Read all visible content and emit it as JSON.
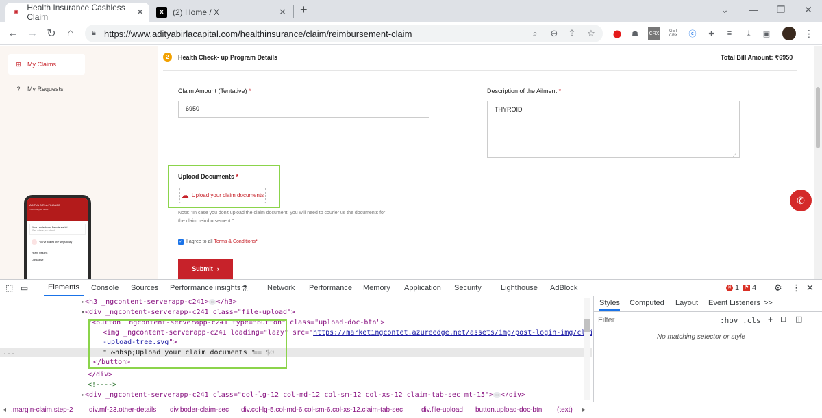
{
  "browser": {
    "tabs": [
      {
        "title": "Health Insurance Cashless Claim",
        "active": true,
        "icon": "aditya-birla-logo"
      },
      {
        "title": "(2) Home / X",
        "active": false,
        "icon": "x-logo"
      }
    ],
    "new_tab": "+",
    "url": "https://www.adityabirlacapital.com/healthinsurance/claim/reimbursement-claim",
    "extensions": [
      "opera-icon",
      "profile-icon",
      "crx-icon",
      "get-crx-icon",
      "clipboard-icon",
      "puzzle-icon",
      "media-icon",
      "download-icon",
      "sidepanel-icon",
      "avatar"
    ]
  },
  "sidebar": {
    "items": [
      {
        "label": "My Claims",
        "icon": "claims-icon",
        "active": true
      },
      {
        "label": "My Requests",
        "icon": "requests-icon",
        "active": false
      }
    ],
    "phone": {
      "brand": "ADITYA BIRLA FINANCE",
      "greeting": "Your Today for Good",
      "leader": "Your Leaderboard Results are In!",
      "leader_sub": "See where you stand",
      "steps": "You've walked 5K+ steps today",
      "returns": "Health Returns",
      "cumulative": "Cumulative"
    }
  },
  "form": {
    "step_number": "2",
    "section_title": "Health Check- up Program Details",
    "total_bill": "Total Bill Amount: ₹6950",
    "claim_amount_label": "Claim Amount (Tentative)",
    "claim_amount_value": "6950",
    "ailment_label": "Description of the Ailment",
    "ailment_value": "THYROID",
    "upload_label": "Upload Documents",
    "upload_button": "Upload your claim documents",
    "note_line1": "Note: \"In case you don't upload the claim document, you will need to courier us the documents for",
    "note_line2": "the claim reimbursement.\"",
    "agree_prefix": "I agree to all",
    "agree_link": "Terms & Conditions",
    "submit": "Submit",
    "required_mark": "*"
  },
  "devtools": {
    "tabs": [
      "Elements",
      "Console",
      "Sources",
      "Performance insights",
      "Network",
      "Performance",
      "Memory",
      "Application",
      "Security",
      "Lighthouse",
      "AdBlock"
    ],
    "active_tab": "Elements",
    "error_count": "1",
    "issue_count": "4",
    "code": {
      "l1_tag": "<h3 _ngcontent-serverapp-c241>",
      "l1_close": "</h3>",
      "l2_open": "<div _ngcontent-serverapp-c241 class=\"file-upload\">",
      "l3_button": "<button _ngcontent-serverapp-c241 type=\"button\" class=\"upload-doc-btn\">",
      "l4_img": "<img _ngcontent-serverapp-c241 loading=\"lazy\" src=\"",
      "l4_src": "https://marketingcontet.azureedge.net/assets/img/post-login-img/claim",
      "l5_src": "-upload-tree.svg",
      "l5_close": "\">",
      "l6_text": "\" &nbsp;Upload your claim documents \"",
      "l6_eq": "== $0",
      "l7": "</button>",
      "l8": "</div>",
      "l9": "<!---->",
      "l10": "<div _ngcontent-serverapp-c241 class=\"col-lg-12 col-md-12 col-sm-12 col-xs-12 claim-tab-sec mt-15\">",
      "l10_close": "</div>"
    },
    "styles_tabs": [
      "Styles",
      "Computed",
      "Layout",
      "Event Listeners",
      ">>"
    ],
    "filter_placeholder": "Filter",
    "filter_tools": ":hov  .cls",
    "no_match": "No matching selector or style",
    "breadcrumbs": [
      ".margin-claim.step-2",
      "div.mf-23.other-details",
      "div.boder-claim-sec",
      "div.col-lg-5.col-md-6.col-sm-6.col-xs-12.claim-tab-sec",
      "div.file-upload",
      "button.upload-doc-btn",
      "(text)"
    ]
  },
  "colors": {
    "brand_red": "#c7222a",
    "highlight_green": "#8bd44b",
    "step_orange": "#f2a100",
    "devtools_blue": "#1a73e8"
  }
}
